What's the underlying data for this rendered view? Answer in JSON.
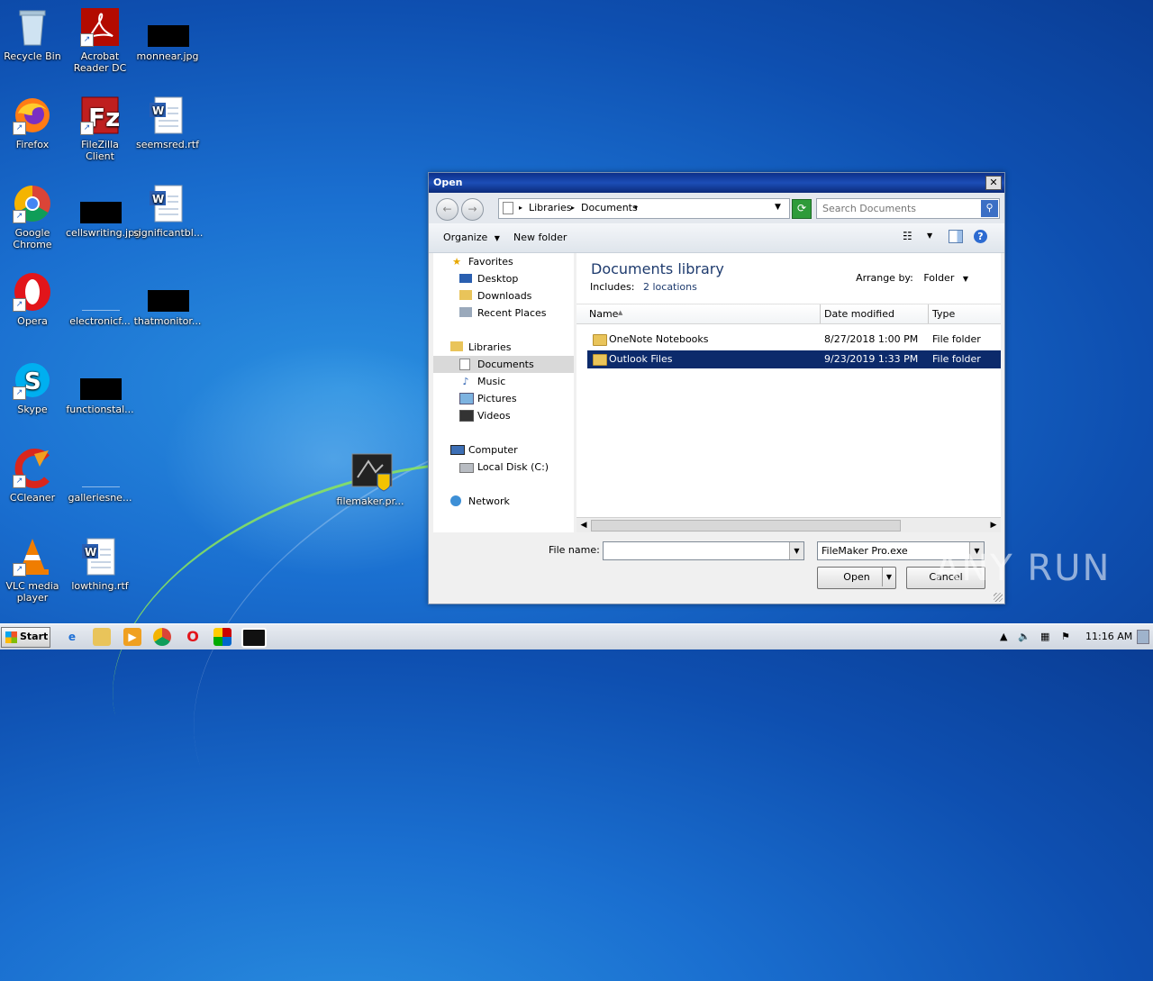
{
  "desktop": {
    "icons": [
      {
        "label": "Recycle Bin"
      },
      {
        "label": "Acrobat Reader DC"
      },
      {
        "label": "monnear.jpg"
      },
      {
        "label": "Firefox"
      },
      {
        "label": "FileZilla Client"
      },
      {
        "label": "seemsred.rtf"
      },
      {
        "label": "Google Chrome"
      },
      {
        "label": "cellswriting.jpg"
      },
      {
        "label": "significantbl..."
      },
      {
        "label": "Opera"
      },
      {
        "label": "electronicf..."
      },
      {
        "label": "thatmonitor..."
      },
      {
        "label": "Skype"
      },
      {
        "label": "functionstal..."
      },
      {
        "label": "CCleaner"
      },
      {
        "label": "galleriesne..."
      },
      {
        "label": "filemaker.pr..."
      },
      {
        "label": "VLC media player"
      },
      {
        "label": "lowthing.rtf"
      }
    ]
  },
  "dialog": {
    "title": "Open",
    "close_glyph": "✕",
    "address": {
      "crumbs": [
        "Libraries",
        "Documents"
      ]
    },
    "search_placeholder": "Search Documents",
    "toolbar": {
      "organize": "Organize",
      "new_folder": "New folder"
    },
    "sidebar": {
      "favorites": "Favorites",
      "desktop": "Desktop",
      "downloads": "Downloads",
      "recent_places": "Recent Places",
      "libraries": "Libraries",
      "documents": "Documents",
      "music": "Music",
      "pictures": "Pictures",
      "videos": "Videos",
      "computer": "Computer",
      "local_disk": "Local Disk (C:)",
      "network": "Network"
    },
    "library": {
      "title": "Documents library",
      "includes_label": "Includes:",
      "includes_value": "2 locations",
      "arrange_label": "Arrange by:",
      "arrange_value": "Folder"
    },
    "columns": {
      "name": "Name",
      "date": "Date modified",
      "type": "Type"
    },
    "files": [
      {
        "name": "OneNote Notebooks",
        "date": "8/27/2018 1:00 PM",
        "type": "File folder"
      },
      {
        "name": "Outlook Files",
        "date": "9/23/2019 1:33 PM",
        "type": "File folder"
      }
    ],
    "file_name_label": "File name:",
    "file_name_value": "",
    "file_type": "FileMaker Pro.exe",
    "open_button": "Open",
    "cancel_button": "Cancel"
  },
  "taskbar": {
    "start": "Start",
    "clock": "11:16 AM"
  },
  "watermark": "ANY RUN"
}
